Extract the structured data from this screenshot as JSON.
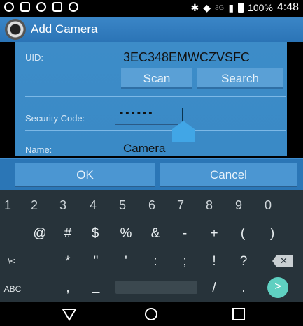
{
  "status_bar": {
    "battery": "100%",
    "time": "4:48",
    "network": "3G",
    "left_icons": [
      "notification-icon",
      "image-icon",
      "whatsapp-icon",
      "message-icon",
      "settings-icon"
    ],
    "right_icons": [
      "bluetooth-icon",
      "wifi-icon",
      "signal-icon",
      "battery-icon"
    ]
  },
  "app_bar": {
    "title": "Add Camera",
    "icon": "camera-app-icon"
  },
  "dialog": {
    "uid_label": "UID:",
    "uid_value": "3EC348EMWCZVSFC",
    "scan_label": "Scan",
    "search_label": "Search",
    "security_label": "Security Code:",
    "security_value": "••••••",
    "name_label": "Name:",
    "name_value": "Camera"
  },
  "actions": {
    "ok_label": "OK",
    "cancel_label": "Cancel"
  },
  "keyboard": {
    "row1": [
      "1",
      "2",
      "3",
      "4",
      "5",
      "6",
      "7",
      "8",
      "9",
      "0"
    ],
    "row2": [
      "@",
      "#",
      "$",
      "%",
      "&",
      "-",
      "+",
      "(",
      ")"
    ],
    "row3": [
      "=\\<",
      "*",
      "\"",
      "'",
      ":",
      ";",
      "!",
      "?"
    ],
    "row4": [
      "ABC",
      ",",
      "_",
      "/",
      "."
    ]
  },
  "colors": {
    "accent": "#2b76b6",
    "dialog": "#3a8ac6",
    "keyboard": "#27333a",
    "go": "#5fd0c1"
  }
}
